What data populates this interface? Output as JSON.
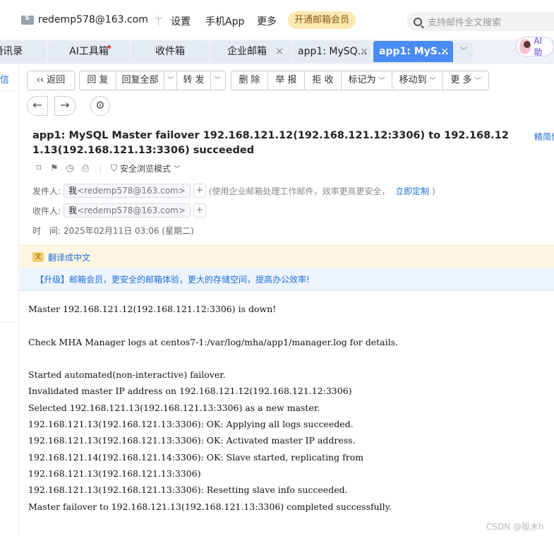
{
  "topbar": {
    "account": "redemp578@163.com",
    "links": [
      "设置",
      "手机App",
      "更多"
    ],
    "vip_button": "开通邮箱会员",
    "search_placeholder": "支持邮件全文搜索"
  },
  "tabs": [
    {
      "label": "通讯录"
    },
    {
      "label": "AI工具箱"
    },
    {
      "label": "收件箱"
    },
    {
      "label": "企业邮箱",
      "close": "×"
    },
    {
      "label": "app1: MySQ...",
      "close": "×"
    },
    {
      "label": "app1: MyS...",
      "close": "×"
    }
  ],
  "ai_assistant": "AI助",
  "left_panel": {
    "label": "信"
  },
  "toolbar": {
    "back": "返回",
    "reply": "回 复",
    "reply_all": "回复全部",
    "forward": "转 发",
    "delete": "删 除",
    "report": "举 报",
    "reject": "拒 收",
    "mark_as": "标记为",
    "move_to": "移动到",
    "more": "更 多"
  },
  "mail": {
    "subject": "app1: MySQL Master failover 192.168.121.12(192.168.121.12:3306) to 192.168.121.13(192.168.121.13:3306) succeeded",
    "simple_view": "精简信",
    "safe_mode": "安全浏览模式",
    "from_label": "发件人:",
    "from_name": "我",
    "from_addr": "<redemp578@163.com>",
    "from_note": "(使用企业邮箱处理工作邮件，效率更高更安全，",
    "from_note_link": "立即定制",
    "from_note_end": ")",
    "to_label": "收件人:",
    "to_name": "我",
    "to_addr": "<redemp578@163.com>",
    "time_label": "时　间:",
    "time_value": "2025年02月11日 03:06 (星期二)",
    "translate": "翻译成中文",
    "promo": "【升级】邮箱会员，更安全的邮箱体验，更大的存储空间，提高办公效率!",
    "body_lines": [
      "Master 192.168.121.12(192.168.121.12:3306) is down!",
      "",
      "Check MHA Manager logs at centos7-1:/var/log/mha/app1/manager.log for details.",
      "",
      "Started automated(non-interactive) failover.",
      "Invalidated master IP address on 192.168.121.12(192.168.121.12:3306)",
      "Selected 192.168.121.13(192.168.121.13:3306) as a new master.",
      "192.168.121.13(192.168.121.13:3306): OK: Applying all logs succeeded.",
      "192.168.121.13(192.168.121.13:3306): OK: Activated master IP address.",
      "192.168.121.14(192.168.121.14:3306): OK: Slave started, replicating from",
      "192.168.121.13(192.168.121.13:3306)",
      "192.168.121.13(192.168.121.13:3306): Resetting slave info succeeded.",
      "Master failover to 192.168.121.13(192.168.121.13:3306) completed successfully."
    ]
  },
  "watermark": "CSDN @殷木h"
}
